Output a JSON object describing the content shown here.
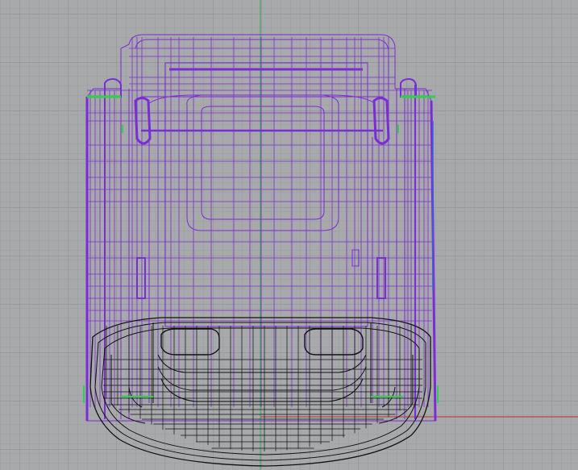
{
  "viewport": {
    "view": "top",
    "display_mode": "wireframe",
    "grid": true,
    "axes": {
      "x_axis_color": "#b8312f",
      "y_axis_color": "#2fa84f"
    }
  },
  "colors": {
    "background": "#a8a9ab",
    "grid_minor": "#9d9ea1",
    "grid_major": "#8f9093",
    "seat_wire": "#7a2cd6",
    "seat_wire_dark": "#6a1fc4",
    "cushion_wire": "#111111",
    "accent_green": "#2fd14a",
    "accent_blue": "#3a5fe0"
  },
  "objects": [
    {
      "name": "seat-back-frame",
      "color_key": "seat_wire"
    },
    {
      "name": "seat-cushion-frame",
      "color_key": "cushion_wire"
    }
  ]
}
